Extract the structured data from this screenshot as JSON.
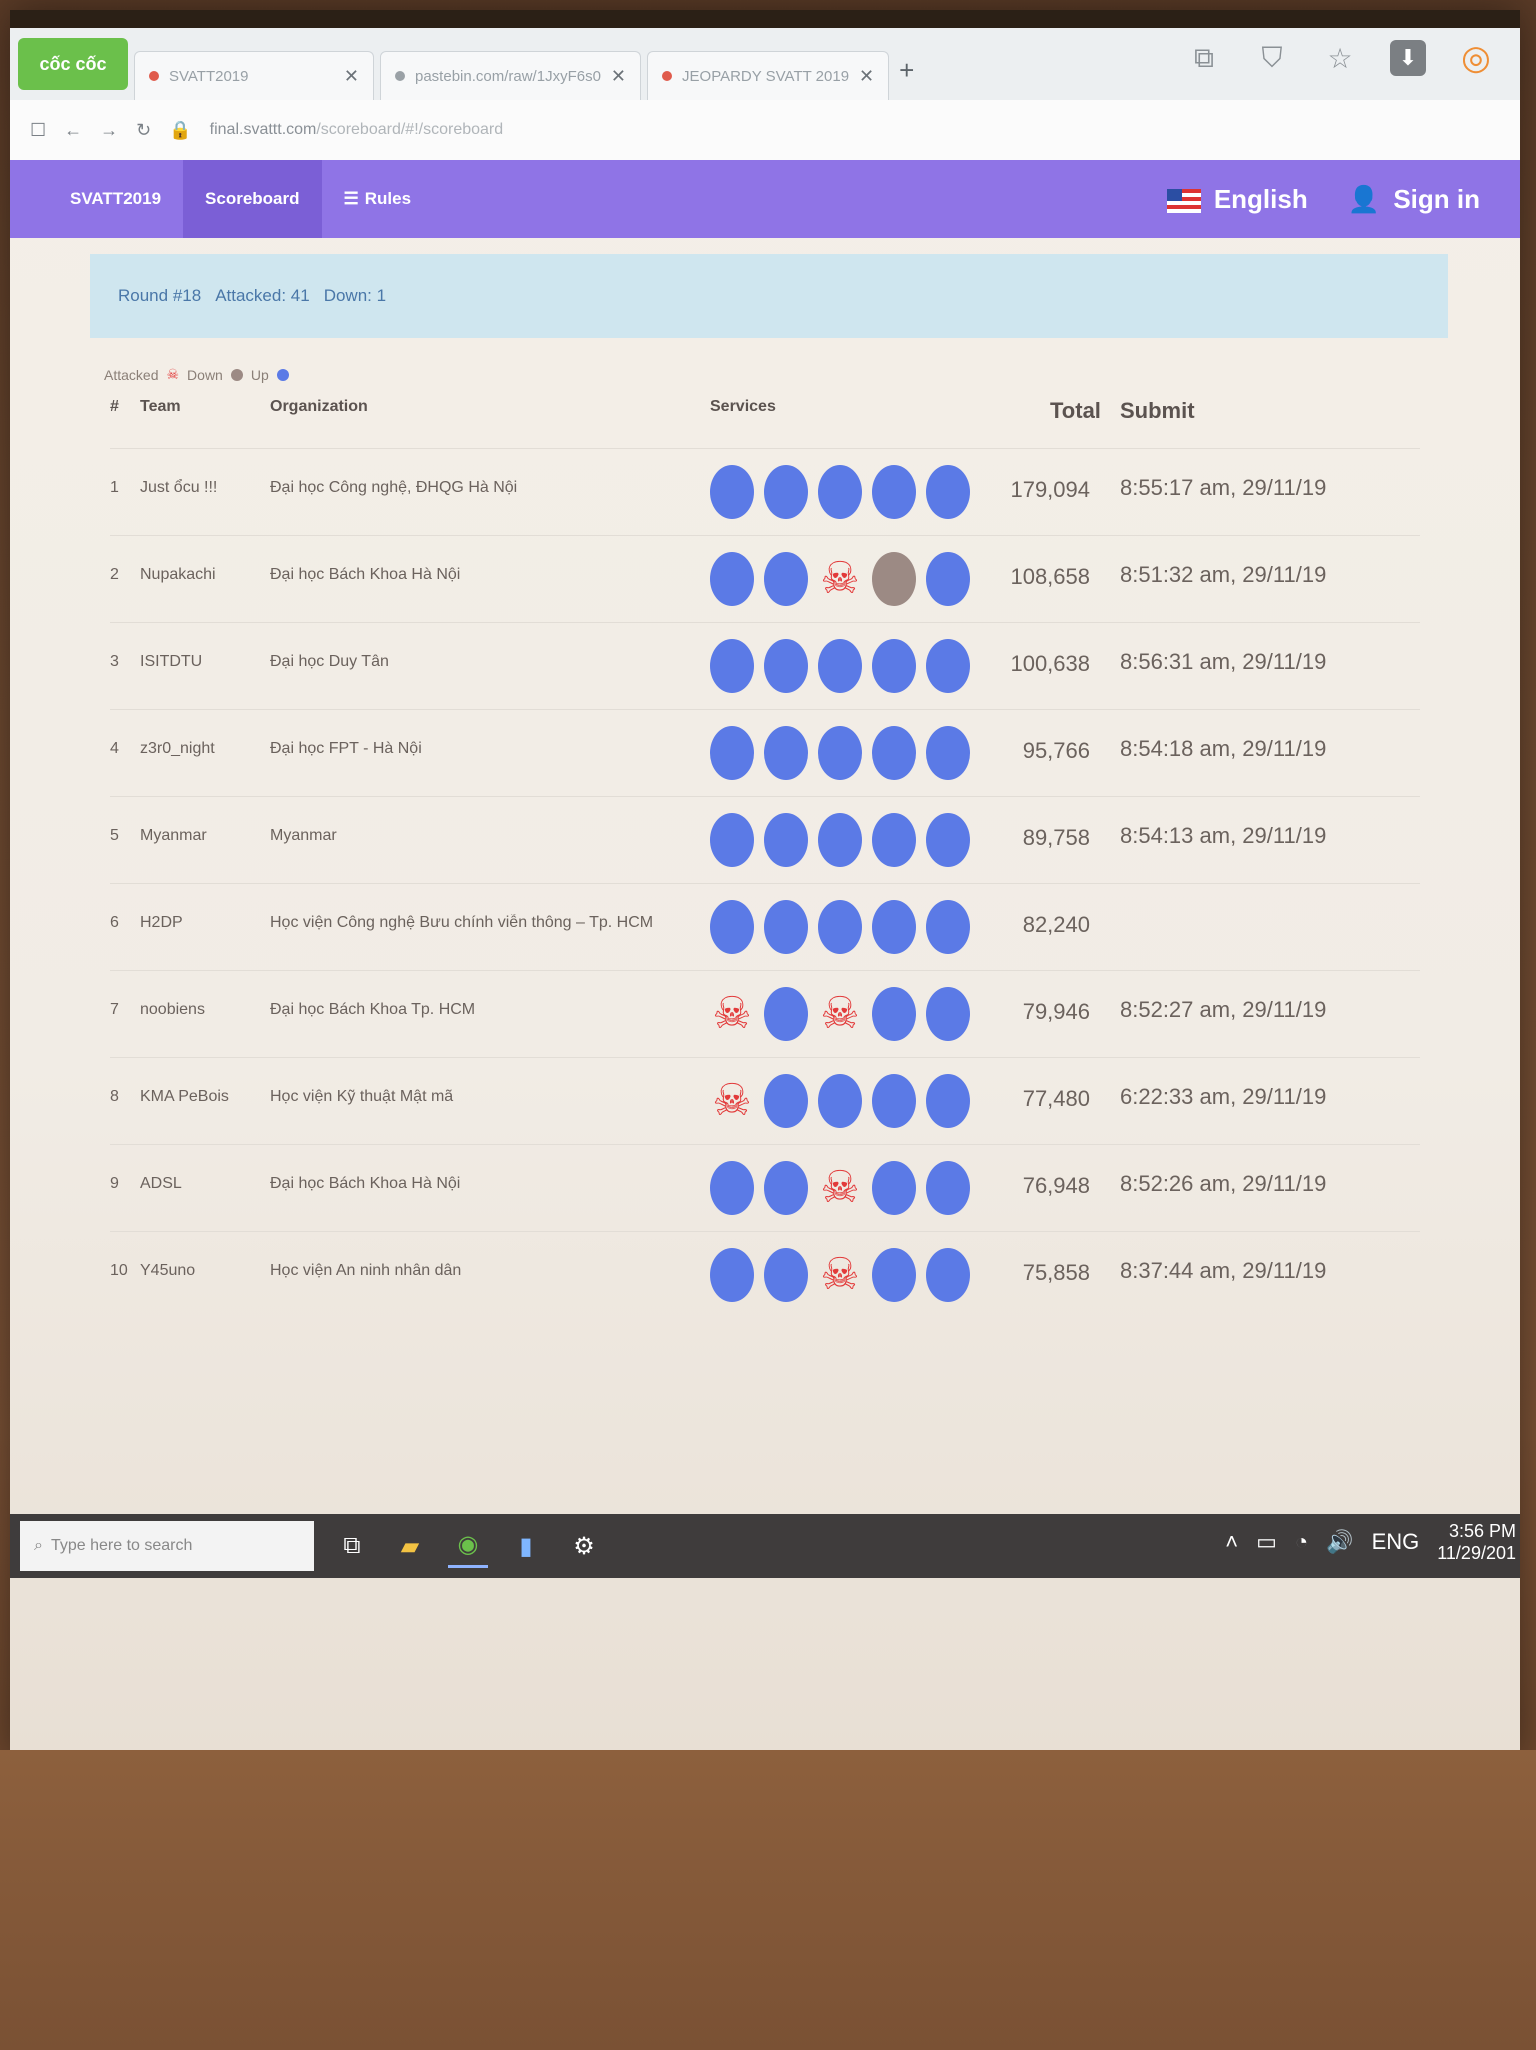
{
  "browser": {
    "brand": "cốc cốc",
    "tabs": [
      {
        "label": "SVATT2019"
      },
      {
        "label": "pastebin.com/raw/1JxyF6s0"
      },
      {
        "label": "JEOPARDY SVATT 2019"
      }
    ],
    "new_tab_label": "+",
    "url": {
      "host": "final.svattt.com",
      "path": "/scoreboard/#!/scoreboard"
    }
  },
  "site": {
    "brand": "SVATT2019",
    "nav": [
      "Scoreboard",
      "Rules"
    ],
    "language": "English",
    "sign_in": "Sign in"
  },
  "status": {
    "round": "Round #18",
    "attacked": "Attacked: 41",
    "down": "Down: 1"
  },
  "legend": {
    "attacked": "Attacked",
    "down": "Down",
    "up": "Up"
  },
  "columns": {
    "rank": "#",
    "team": "Team",
    "organization": "Organization",
    "services": "Services",
    "total": "Total",
    "submit": "Submit"
  },
  "rows": [
    {
      "rank": "1",
      "team": "Just ổcu !!!",
      "organization": "Đại học Công nghệ, ĐHQG Hà Nội",
      "services": [
        "up",
        "up",
        "up",
        "up",
        "up"
      ],
      "total": "179,094",
      "submit": "8:55:17 am, 29/11/19"
    },
    {
      "rank": "2",
      "team": "Nupakachi",
      "organization": "Đại học Bách Khoa Hà Nội",
      "services": [
        "up",
        "up",
        "attacked",
        "down",
        "up"
      ],
      "total": "108,658",
      "submit": "8:51:32 am, 29/11/19"
    },
    {
      "rank": "3",
      "team": "ISITDTU",
      "organization": "Đại học Duy Tân",
      "services": [
        "up",
        "up",
        "up",
        "up",
        "up"
      ],
      "total": "100,638",
      "submit": "8:56:31 am, 29/11/19"
    },
    {
      "rank": "4",
      "team": "z3r0_night",
      "organization": "Đại học FPT - Hà Nội",
      "services": [
        "up",
        "up",
        "up",
        "up",
        "up"
      ],
      "total": "95,766",
      "submit": "8:54:18 am, 29/11/19"
    },
    {
      "rank": "5",
      "team": "Myanmar",
      "organization": "Myanmar",
      "services": [
        "up",
        "up",
        "up",
        "up",
        "up"
      ],
      "total": "89,758",
      "submit": "8:54:13 am, 29/11/19"
    },
    {
      "rank": "6",
      "team": "H2DP",
      "organization": "Học viện Công nghệ Bưu chính viễn thông – Tp. HCM",
      "services": [
        "up",
        "up",
        "up",
        "up",
        "up"
      ],
      "total": "82,240",
      "submit": ""
    },
    {
      "rank": "7",
      "team": "noobiens",
      "organization": "Đại học Bách Khoa Tp. HCM",
      "services": [
        "attacked",
        "up",
        "attacked",
        "up",
        "up"
      ],
      "total": "79,946",
      "submit": "8:52:27 am, 29/11/19"
    },
    {
      "rank": "8",
      "team": "KMA PeBois",
      "organization": "Học viện Kỹ thuật Mật mã",
      "services": [
        "attacked",
        "up",
        "up",
        "up",
        "up"
      ],
      "total": "77,480",
      "submit": "6:22:33 am, 29/11/19"
    },
    {
      "rank": "9",
      "team": "ADSL",
      "organization": "Đại học Bách Khoa Hà Nội",
      "services": [
        "up",
        "up",
        "attacked",
        "up",
        "up"
      ],
      "total": "76,948",
      "submit": "8:52:26 am, 29/11/19"
    },
    {
      "rank": "10",
      "team": "Y45uno",
      "organization": "Học viện An ninh nhân dân",
      "services": [
        "up",
        "up",
        "attacked",
        "up",
        "up"
      ],
      "total": "75,858",
      "submit": "8:37:44 am, 29/11/19"
    }
  ],
  "taskbar": {
    "search_placeholder": "Type here to search",
    "language": "ENG",
    "time": "3:56 PM",
    "date": "11/29/201"
  },
  "colors": {
    "nav_purple": "#8f74e6",
    "service_up": "#5b7ae6",
    "service_down": "#9c8a84",
    "service_attacked": "#e23a3a",
    "banner": "#cfe6ef"
  }
}
